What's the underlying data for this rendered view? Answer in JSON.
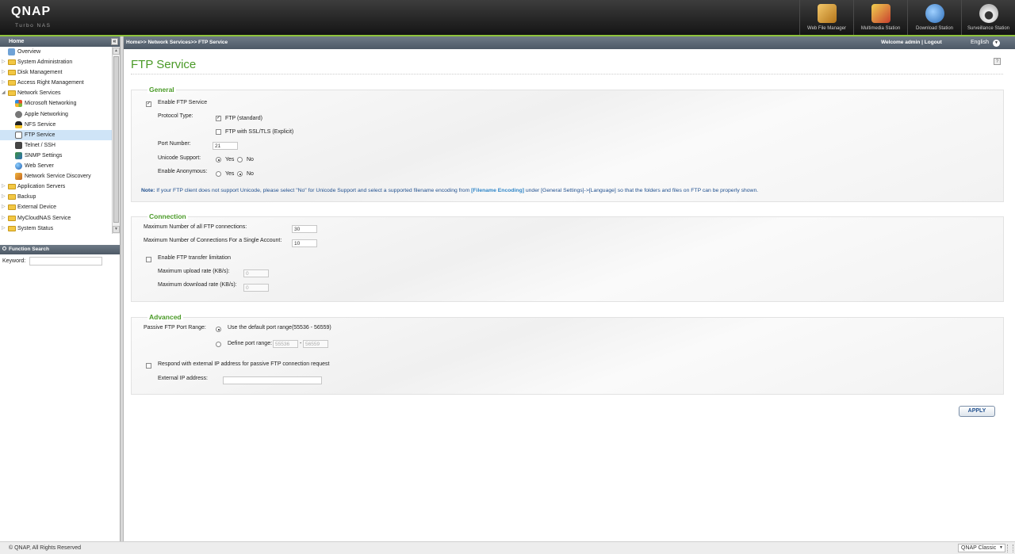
{
  "header": {
    "logo": "QNAP",
    "logo_sub": "Turbo NAS",
    "apps": [
      {
        "label": "Web File Manager",
        "icon": "file-manager-icon",
        "color": "#d99a2b"
      },
      {
        "label": "Multimedia Station",
        "icon": "multimedia-icon",
        "color": "#c9402e"
      },
      {
        "label": "Download Station",
        "icon": "download-icon",
        "color": "#3b83c9"
      },
      {
        "label": "Surveillance Station",
        "icon": "camera-icon",
        "color": "#d8d8d8"
      }
    ]
  },
  "sidebar": {
    "home_label": "Home",
    "collapse_glyph": "«",
    "items": [
      {
        "label": "Overview",
        "level": 0,
        "icon": "overview-icon",
        "arrow": ""
      },
      {
        "label": "System Administration",
        "level": 0,
        "icon": "folder-icon",
        "arrow": "▷"
      },
      {
        "label": "Disk Management",
        "level": 0,
        "icon": "folder-icon",
        "arrow": "▷"
      },
      {
        "label": "Access Right Management",
        "level": 0,
        "icon": "folder-icon",
        "arrow": "▷"
      },
      {
        "label": "Network Services",
        "level": 0,
        "icon": "folder-open-icon",
        "arrow": "◢"
      },
      {
        "label": "Microsoft Networking",
        "level": 1,
        "icon": "windows-icon",
        "arrow": ""
      },
      {
        "label": "Apple Networking",
        "level": 1,
        "icon": "apple-icon",
        "arrow": ""
      },
      {
        "label": "NFS Service",
        "level": 1,
        "icon": "linux-icon",
        "arrow": ""
      },
      {
        "label": "FTP Service",
        "level": 1,
        "icon": "ftp-icon",
        "arrow": "",
        "selected": true
      },
      {
        "label": "Telnet / SSH",
        "level": 1,
        "icon": "terminal-icon",
        "arrow": ""
      },
      {
        "label": "SNMP Settings",
        "level": 1,
        "icon": "snmp-icon",
        "arrow": ""
      },
      {
        "label": "Web Server",
        "level": 1,
        "icon": "globe-icon",
        "arrow": ""
      },
      {
        "label": "Network Service Discovery",
        "level": 1,
        "icon": "discovery-icon",
        "arrow": ""
      },
      {
        "label": "Application Servers",
        "level": 0,
        "icon": "folder-icon",
        "arrow": "▷"
      },
      {
        "label": "Backup",
        "level": 0,
        "icon": "folder-icon",
        "arrow": "▷"
      },
      {
        "label": "External Device",
        "level": 0,
        "icon": "folder-icon",
        "arrow": "▷"
      },
      {
        "label": "MyCloudNAS Service",
        "level": 0,
        "icon": "folder-icon",
        "arrow": "▷"
      },
      {
        "label": "System Status",
        "level": 0,
        "icon": "folder-icon",
        "arrow": "▷"
      }
    ],
    "function_search": {
      "title": "Function Search",
      "keyword_label": "Keyword:",
      "keyword_value": ""
    }
  },
  "topbar": {
    "breadcrumb": "Home>> Network Services>> FTP Service",
    "welcome": "Welcome admin | Logout",
    "language": "English"
  },
  "page": {
    "title": "FTP Service",
    "general": {
      "title": "General",
      "enable_ftp": {
        "label": "Enable FTP Service",
        "checked": true
      },
      "protocol_label": "Protocol Type:",
      "ftp_standard": {
        "label": "FTP (standard)",
        "checked": true
      },
      "ftp_ssl": {
        "label": "FTP with SSL/TLS (Explicit)",
        "checked": false
      },
      "port_label": "Port Number:",
      "port_value": "21",
      "unicode_label": "Unicode Support:",
      "unicode_value": "Yes",
      "anonymous_label": "Enable Anonymous:",
      "anonymous_value": "No",
      "yes_label": "Yes",
      "no_label": "No",
      "note_prefix": "Note:",
      "note_text1": " If your FTP client does not support Unicode, please select \"No\" for Unicode Support and select a supported filename encoding from ",
      "note_link": "[Filename Encoding]",
      "note_text2": " under [General Settings]->[Language] so that the folders and files on FTP can be properly shown."
    },
    "connection": {
      "title": "Connection",
      "max_all_label": "Maximum Number of all FTP connections:",
      "max_all_value": "30",
      "max_single_label": "Maximum Number of Connections For a Single Account:",
      "max_single_value": "10",
      "transfer_limit": {
        "label": "Enable FTP transfer limitation",
        "checked": false
      },
      "upload_label": "Maximum upload rate (KB/s):",
      "upload_value": "0",
      "download_label": "Maximum download rate (KB/s):",
      "download_value": "0"
    },
    "advanced": {
      "title": "Advanced",
      "passive_label": "Passive FTP Port Range:",
      "default_range_label": "Use the default port range(55536 - 56559)",
      "default_selected": true,
      "define_range_label": "Define port range:",
      "range_start": "55536",
      "range_sep": "-",
      "range_end": "56559",
      "external_ip": {
        "label": "Respond with external IP address for passive FTP connection request",
        "checked": false
      },
      "external_ip_label": "External IP address:",
      "external_ip_value": ""
    },
    "apply_label": "APPLY"
  },
  "footer": {
    "copyright": "© QNAP, All Rights Reserved",
    "theme": "QNAP Classic"
  },
  "colors": {
    "accent_green": "#4a9a27",
    "header_dark": "#141414",
    "note_blue": "#1f4f8e",
    "link_blue": "#2f86c8"
  }
}
